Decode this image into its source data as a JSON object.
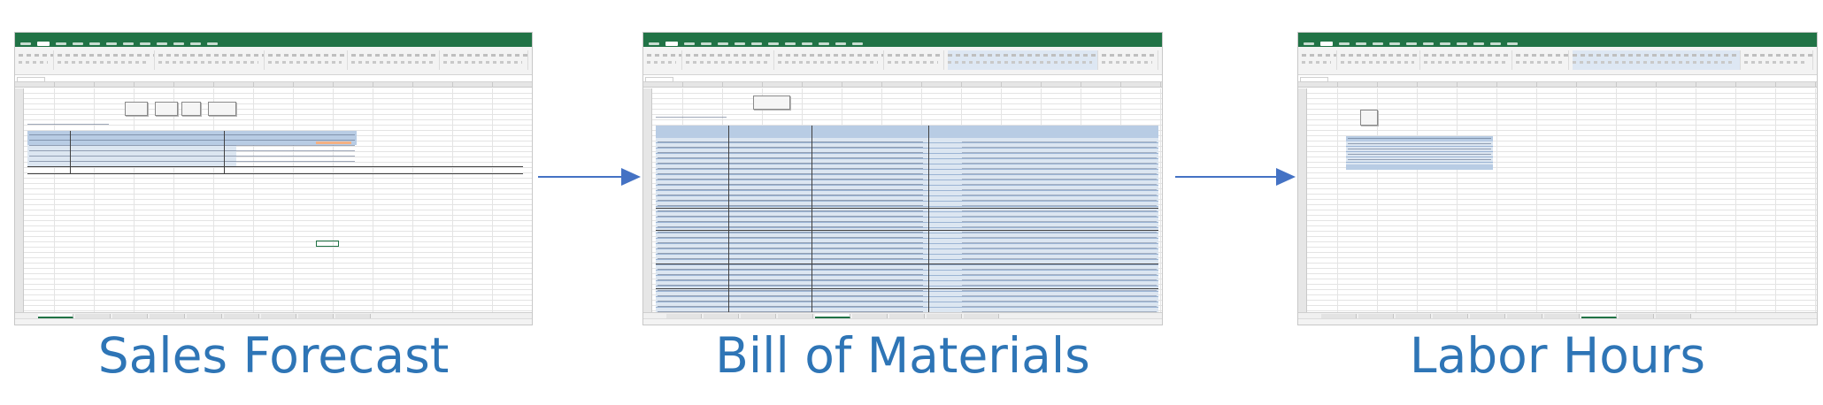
{
  "captions": {
    "sales_forecast": "Sales Forecast",
    "bill_of_materials": "Bill of Materials",
    "labor_hours": "Labor Hours"
  },
  "colors": {
    "excel_green": "#217346",
    "table_blue": "#dce6f1",
    "header_blue": "#b8cce4",
    "arrow": "#4472c4",
    "caption": "#2e75b6"
  },
  "icons": {
    "flow_arrow": "right-arrow-icon"
  }
}
